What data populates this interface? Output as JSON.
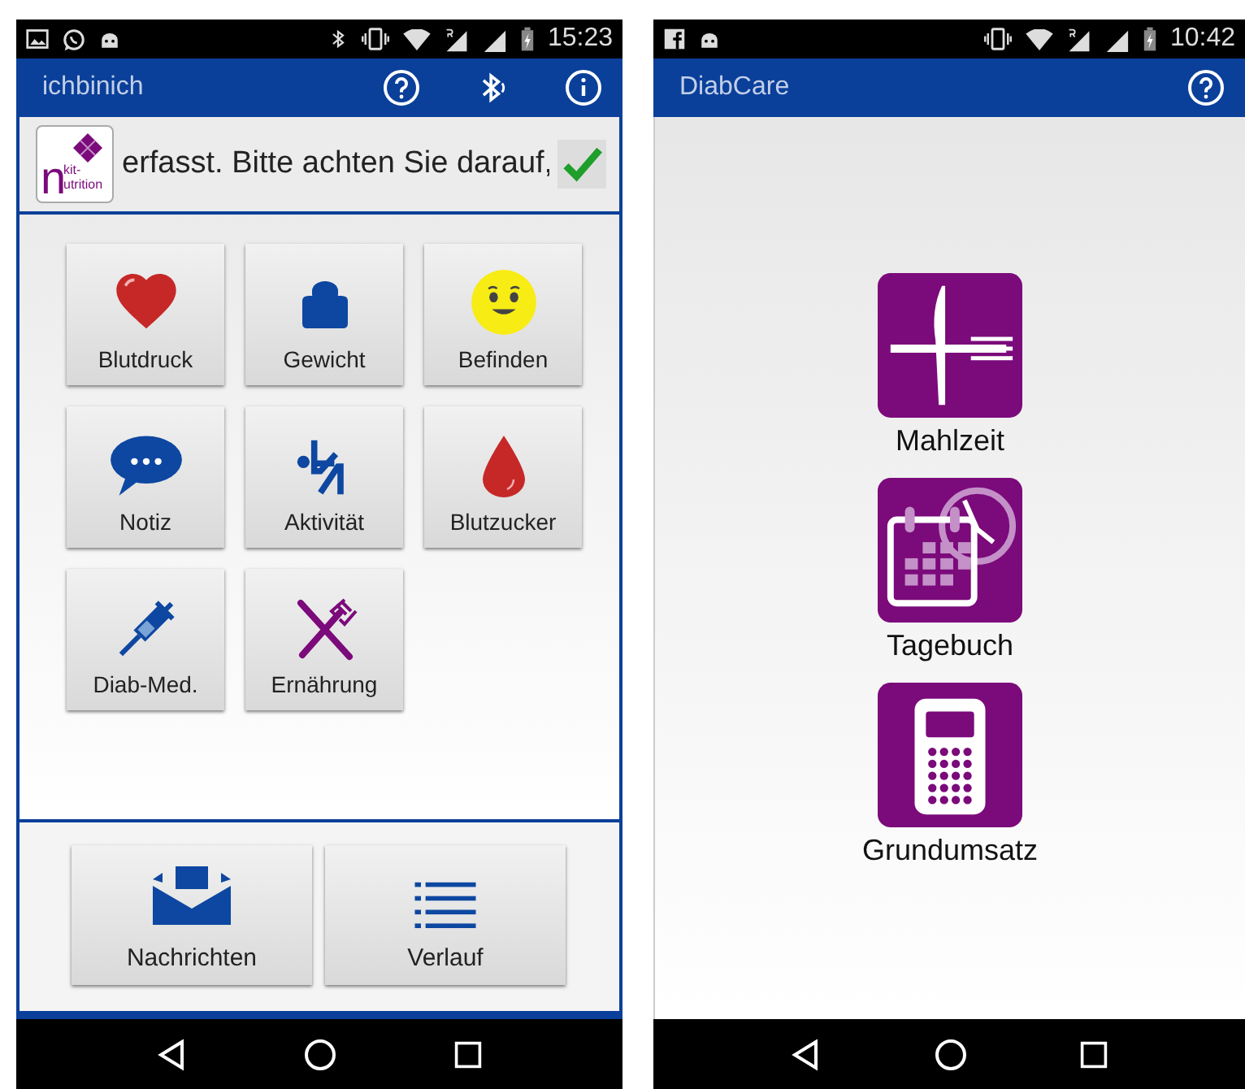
{
  "screens": [
    {
      "kind": "dashboard",
      "status_time": "15:23",
      "app_title": "ichbinich",
      "banner": {
        "logo_initial": "n",
        "logo_top": "kit-",
        "logo_rest": "utrition",
        "ticker": "erfasst. Bitte achten Sie darauf,"
      },
      "tiles": [
        {
          "label": "Blutdruck"
        },
        {
          "label": "Gewicht"
        },
        {
          "label": "Befinden"
        },
        {
          "label": "Notiz"
        },
        {
          "label": "Aktivität"
        },
        {
          "label": "Blutzucker"
        },
        {
          "label": "Diab-Med."
        },
        {
          "label": "Ernährung"
        }
      ],
      "bottom_buttons": [
        {
          "label": "Nachrichten"
        },
        {
          "label": "Verlauf"
        }
      ]
    },
    {
      "kind": "launcher",
      "status_time": "10:42",
      "app_title": "DiabCare",
      "items": [
        {
          "label": "Mahlzeit"
        },
        {
          "label": "Tagebuch"
        },
        {
          "label": "Grundumsatz"
        }
      ]
    }
  ]
}
